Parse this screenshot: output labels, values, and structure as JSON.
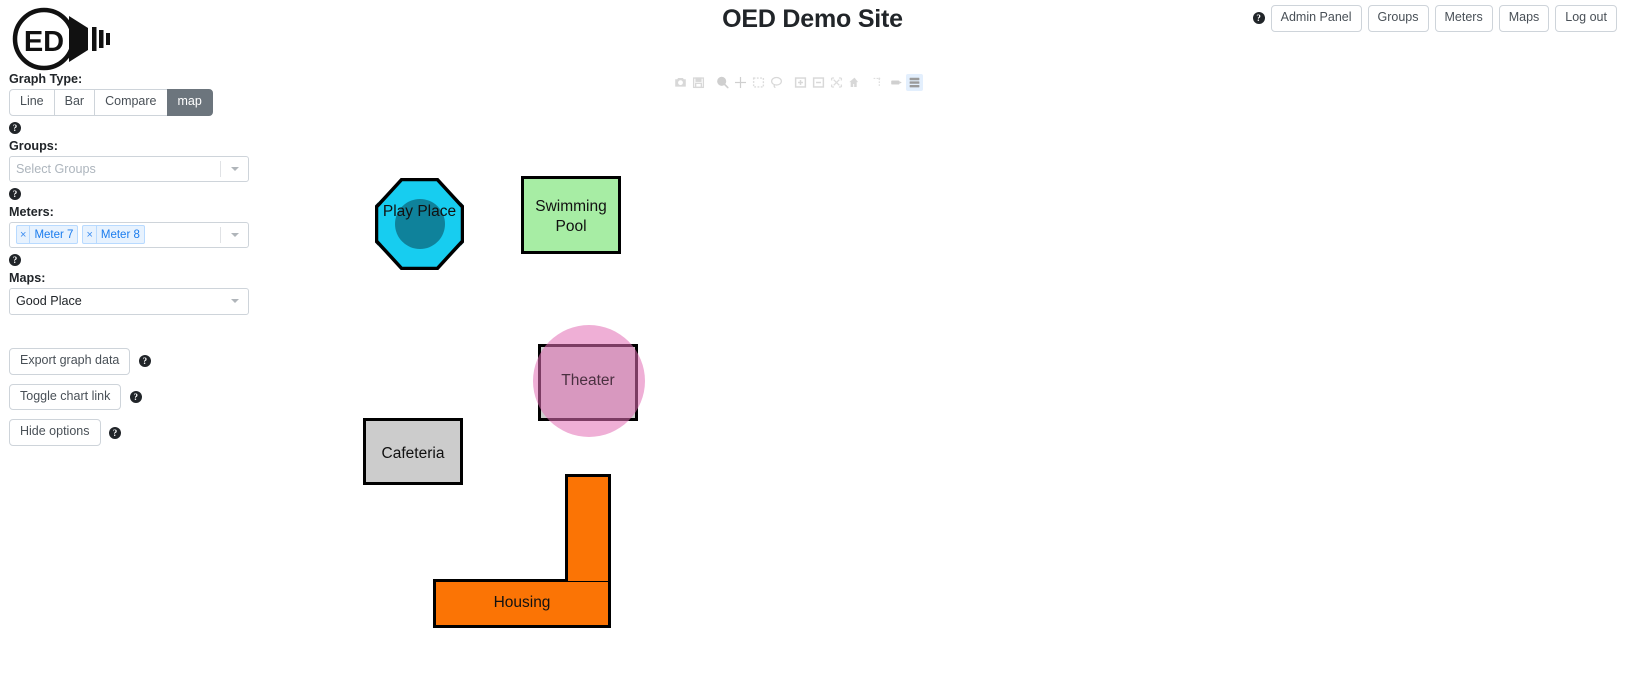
{
  "header": {
    "title": "OED Demo Site",
    "logo_text": "ED",
    "logo_name": "oed-lightbulb-logo",
    "help_icon": "?",
    "nav_buttons": [
      {
        "label": "Admin Panel",
        "name": "admin-panel"
      },
      {
        "label": "Groups",
        "name": "groups"
      },
      {
        "label": "Meters",
        "name": "meters"
      },
      {
        "label": "Maps",
        "name": "maps"
      },
      {
        "label": "Log out",
        "name": "log-out"
      }
    ]
  },
  "sidebar": {
    "graph_type": {
      "label": "Graph Type:",
      "options": [
        "Line",
        "Bar",
        "Compare",
        "map"
      ],
      "selected": "map",
      "help_icon": "?"
    },
    "groups": {
      "label": "Groups:",
      "placeholder": "Select Groups",
      "selected": [],
      "help_icon": "?"
    },
    "meters": {
      "label": "Meters:",
      "placeholder": "",
      "chips": [
        "Meter 7",
        "Meter 8"
      ],
      "chip_remove_glyph": "×",
      "help_icon": "?"
    },
    "maps": {
      "label": "Maps:",
      "selected": "Good Place"
    },
    "actions": [
      {
        "label": "Export graph data",
        "name": "export-graph-data",
        "help_icon": "?"
      },
      {
        "label": "Toggle chart link",
        "name": "toggle-chart-link",
        "help_icon": "?"
      },
      {
        "label": "Hide options",
        "name": "hide-options",
        "help_icon": "?"
      }
    ]
  },
  "plot_toolbar": {
    "icons": [
      {
        "name": "download-plot-png-icon",
        "selected": false
      },
      {
        "name": "save-icon",
        "selected": false
      },
      {
        "name": "zoom-icon",
        "selected": false
      },
      {
        "name": "pan-icon",
        "selected": false
      },
      {
        "name": "box-select-icon",
        "selected": false
      },
      {
        "name": "lasso-select-icon",
        "selected": false
      },
      {
        "name": "zoom-in-icon",
        "selected": false
      },
      {
        "name": "zoom-out-icon",
        "selected": false
      },
      {
        "name": "autoscale-icon",
        "selected": false
      },
      {
        "name": "reset-axes-icon",
        "selected": false
      },
      {
        "name": "toggle-spike-lines-icon",
        "selected": false
      },
      {
        "name": "hover-compare-data-icon",
        "selected": false
      },
      {
        "name": "show-closest-data-icon",
        "selected": true
      }
    ]
  },
  "map": {
    "name": "Good Place",
    "shapes": [
      {
        "name": "play-place",
        "label": "Play Place",
        "type": "octagon",
        "fill": "#17cdf0",
        "stroke": "#000000",
        "has_meter_bubble": true,
        "bubble_color": "rgba(10,70,85,0.55)"
      },
      {
        "name": "swimming-pool",
        "label": "Swimming Pool",
        "type": "rectangle",
        "fill": "#a7eda4",
        "stroke": "#000000",
        "has_meter_bubble": false
      },
      {
        "name": "theater",
        "label": "Theater",
        "type": "rectangle",
        "fill": "#cccccc",
        "stroke": "#000000",
        "has_meter_bubble": true,
        "bubble_color": "rgba(226,110,180,0.55)"
      },
      {
        "name": "cafeteria",
        "label": "Cafeteria",
        "type": "rectangle",
        "fill": "#cccccc",
        "stroke": "#000000",
        "has_meter_bubble": false
      },
      {
        "name": "housing",
        "label": "Housing",
        "type": "l-shape",
        "fill": "#fb7405",
        "stroke": "#000000",
        "has_meter_bubble": false
      }
    ]
  }
}
